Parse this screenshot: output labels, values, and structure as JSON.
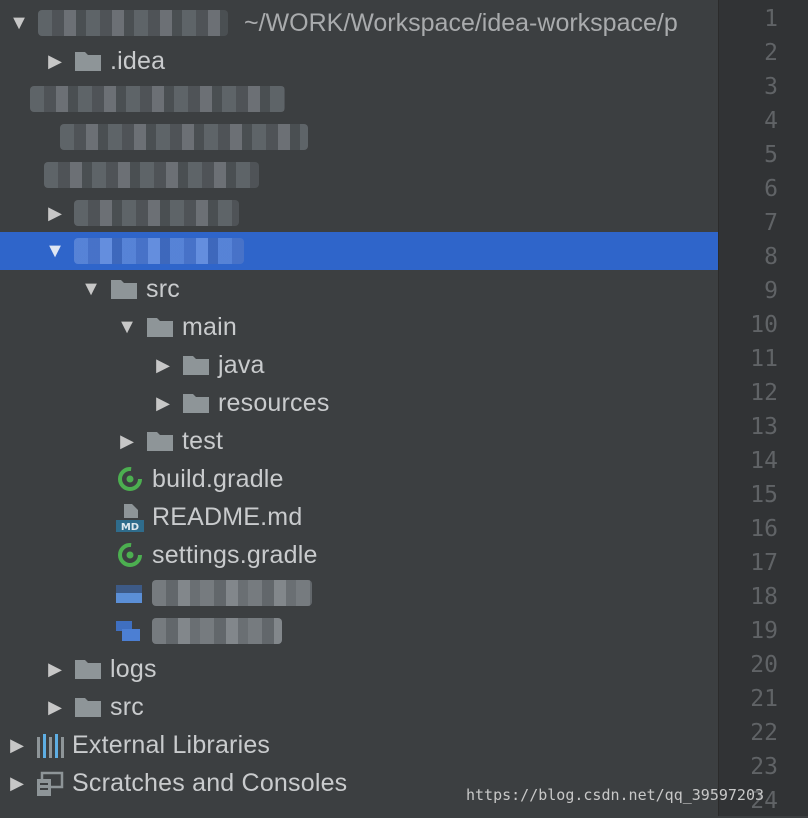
{
  "project": {
    "path": "~/WORK/Workspace/idea-workspace/p"
  },
  "tree": {
    "idea_folder": ".idea",
    "module": {
      "src": "src",
      "main": "main",
      "java": "java",
      "resources": "resources",
      "test": "test",
      "build_gradle": "build.gradle",
      "readme": "README.md",
      "readme_badge": "MD",
      "settings_gradle": "settings.gradle"
    },
    "logs": "logs",
    "src": "src",
    "external_libraries": "External Libraries",
    "scratches": "Scratches and Consoles"
  },
  "gutter": {
    "line_numbers": [
      "1",
      "2",
      "3",
      "4",
      "5",
      "6",
      "7",
      "8",
      "9",
      "10",
      "11",
      "12",
      "13",
      "14",
      "15",
      "16",
      "17",
      "18",
      "19",
      "20",
      "21",
      "22",
      "23",
      "24"
    ]
  },
  "watermark": "https://blog.csdn.net/qq_39597203",
  "colors": {
    "panel_bg": "#3c3f41",
    "gutter_bg": "#313335",
    "selection": "#2f65ca",
    "folder": "#8e9598",
    "gradle_green": "#4caf50"
  }
}
